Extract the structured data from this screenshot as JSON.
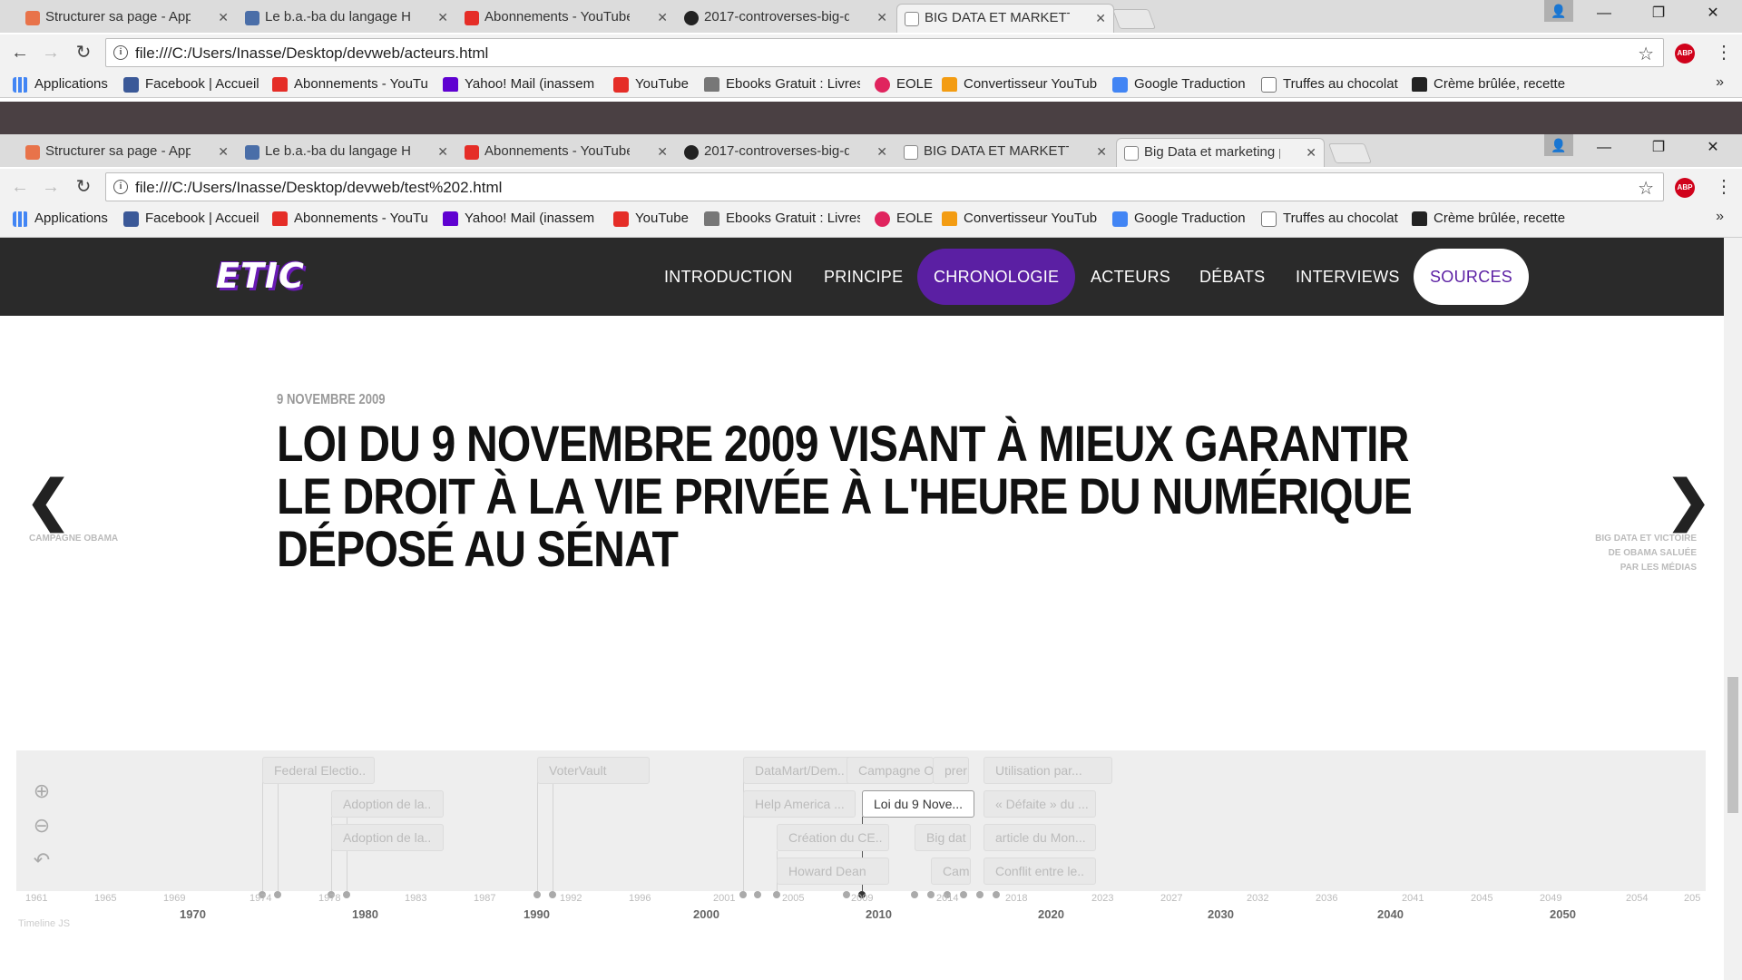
{
  "browser1": {
    "tabs": [
      {
        "label": "Structurer sa page - App",
        "icon_color": "#e8734a"
      },
      {
        "label": "Le b.a.-ba du langage HT",
        "icon_color": "#4a6ea8"
      },
      {
        "label": "Abonnements - YouTube",
        "icon_color": "#e52d27"
      },
      {
        "label": "2017-controverses-big-d",
        "icon_color": "#222222"
      },
      {
        "label": "BIG DATA ET MARKETTIN",
        "icon_color": "#888888"
      }
    ],
    "url": "file:///C:/Users/Inasse/Desktop/devweb/acteurs.html"
  },
  "browser2": {
    "tabs": [
      {
        "label": "Structurer sa page - App",
        "icon_color": "#e8734a"
      },
      {
        "label": "Le b.a.-ba du langage HT",
        "icon_color": "#4a6ea8"
      },
      {
        "label": "Abonnements - YouTube",
        "icon_color": "#e52d27"
      },
      {
        "label": "2017-controverses-big-d",
        "icon_color": "#222222"
      },
      {
        "label": "BIG DATA ET MARKETTIN",
        "icon_color": "#888888"
      },
      {
        "label": "Big Data et marketing pc",
        "icon_color": "#888888"
      }
    ],
    "url": "file:///C:/Users/Inasse/Desktop/devweb/test%202.html"
  },
  "bookmarks": [
    {
      "label": "Applications",
      "icon": "apps-icon",
      "color": "#4285f4"
    },
    {
      "label": "Facebook | Accueil",
      "icon": "facebook-icon",
      "color": "#3b5998"
    },
    {
      "label": "Abonnements - YouTu",
      "icon": "youtube-icon",
      "color": "#e52d27"
    },
    {
      "label": "Yahoo! Mail (inassem",
      "icon": "yahoo-mail-icon",
      "color": "#5f01d1"
    },
    {
      "label": "YouTube",
      "icon": "youtube-icon",
      "color": "#e52d27"
    },
    {
      "label": "Ebooks Gratuit : Livres",
      "icon": "ebook-icon",
      "color": "#777777"
    },
    {
      "label": "EOLE",
      "icon": "eole-icon",
      "color": "#e0245e"
    },
    {
      "label": "Convertisseur YouTub",
      "icon": "converter-icon",
      "color": "#f39c12"
    },
    {
      "label": "Google Traduction",
      "icon": "google-translate-icon",
      "color": "#4285f4"
    },
    {
      "label": "Truffes au chocolat",
      "icon": "page-icon",
      "color": "#ffffff"
    },
    {
      "label": "Crème brûlée, recette",
      "icon": "recipe-icon",
      "color": "#222222"
    }
  ],
  "bookmarks_more": "»",
  "abp_label": "ABP",
  "site": {
    "logo": "ETIC",
    "nav": [
      "INTRODUCTION",
      "PRINCIPE",
      "CHRONOLOGIE",
      "ACTEURS",
      "DÉBATS",
      "INTERVIEWS",
      "SOURCES"
    ],
    "active_nav": "CHRONOLOGIE",
    "accent_color": "#5b1fa3"
  },
  "slide": {
    "date": "9 NOVEMBRE 2009",
    "title": "LOI DU 9 NOVEMBRE 2009 VISANT À MIEUX GARANTIR LE DROIT À LA VIE PRIVÉE À L'HEURE DU NUMÉRIQUE DÉPOSÉ AU SÉNAT",
    "prev_label": "CAMPAGNE OBAMA",
    "next_label": "BIG DATA ET VICTOIRE DE OBAMA SALUÉE PAR LES MÉDIAS"
  },
  "timeline": {
    "markers": [
      "Federal Electio..",
      "Adoption de la..",
      "Adoption de la..",
      "VoterVault",
      "DataMart/Dem..",
      "Campagne O",
      "prer",
      "Utilisation par...",
      "Help America ...",
      "Loi du 9 Nove...",
      "« Défaite » du ...",
      "Création du CE..",
      "Big dat",
      "article du Mon...",
      "Howard Dean",
      "Cam",
      "Conflit entre le.."
    ],
    "minor_ticks": [
      "1961",
      "1965",
      "1969",
      "1974",
      "1978",
      "1983",
      "1987",
      "1992",
      "1996",
      "2001",
      "2005",
      "2009",
      "2014",
      "2018",
      "2023",
      "2027",
      "2032",
      "2036",
      "2041",
      "2045",
      "2049",
      "2054",
      "205"
    ],
    "major_ticks": [
      "1970",
      "1980",
      "1990",
      "2000",
      "2010",
      "2020",
      "2030",
      "2040",
      "2050"
    ],
    "credit": "Timeline JS"
  }
}
